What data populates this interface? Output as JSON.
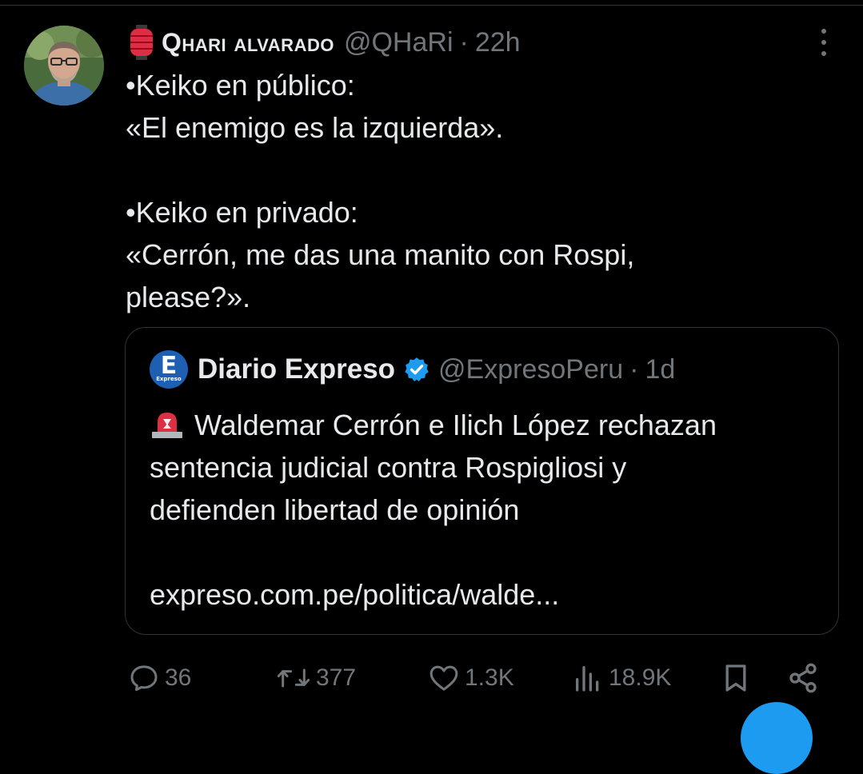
{
  "tweet": {
    "author": {
      "display_name": "Qhari alvarado",
      "handle": "@QHaRi",
      "dot": "·",
      "time": "22h",
      "name_emoji": "red-paper-lantern-icon"
    },
    "text_lines": [
      "•Keiko en público:",
      "«El enemigo es la izquierda».",
      "",
      "•Keiko en privado:",
      "«Cerrón, me das una manito con Rospi,",
      "please?»."
    ]
  },
  "quote": {
    "author": {
      "display_name": "Diario Expreso",
      "handle": "@ExpresoPeru",
      "dot": "·",
      "time": "1d",
      "verified": true,
      "avatar_letter": "E",
      "avatar_word": "Expreso",
      "avatar_color": "#1f5fb3"
    },
    "text_lines": [
      "Waldemar Cerrón e Ilich López rechazan",
      "sentencia judicial contra Rospigliosi y",
      "defienden libertad de opinión"
    ],
    "link": "expreso.com.pe/politica/walde..."
  },
  "actions": {
    "replies": "36",
    "retweets": "377",
    "likes": "1.3K",
    "views": "18.9K"
  },
  "colors": {
    "background": "#000000",
    "text": "#e7e9ea",
    "secondary": "#71767b",
    "border": "#2f3336",
    "accent": "#1d9bf0"
  }
}
